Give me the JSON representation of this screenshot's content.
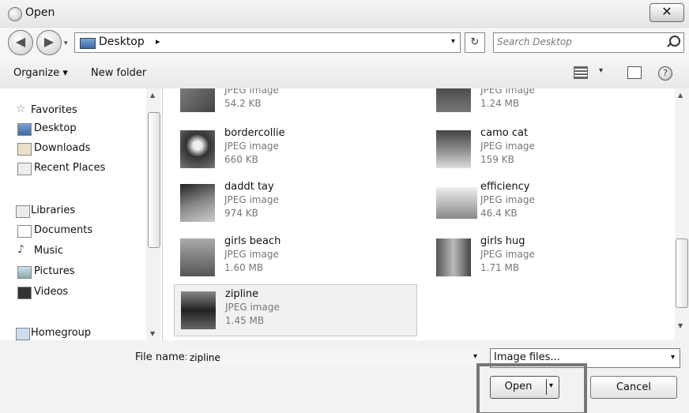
{
  "window": {
    "title": "Open",
    "close_glyph": "✕"
  },
  "nav_buttons": {
    "back_glyph": "◀",
    "forward_glyph": "▶",
    "dropdown_glyph": "▾"
  },
  "address": {
    "path": "Desktop",
    "separator": "▸",
    "dropdown_glyph": "▾",
    "refresh_glyph": "↻"
  },
  "search": {
    "placeholder": "Search Desktop"
  },
  "toolbar": {
    "organize_label": "Organize ▾",
    "new_folder_label": "New folder",
    "view_dropdown_glyph": "▾",
    "help_glyph": "?"
  },
  "nav_pane": {
    "favorites": {
      "label": "Favorites",
      "items": [
        "Desktop",
        "Downloads",
        "Recent Places"
      ]
    },
    "libraries": {
      "label": "Libraries",
      "items": [
        "Documents",
        "Music",
        "Pictures",
        "Videos"
      ]
    },
    "homegroup_label": "Homegroup",
    "scroll_up_glyph": "▲",
    "scroll_down_glyph": "▼"
  },
  "files": [
    {
      "name": "",
      "type": "JPEG image",
      "size": "54.2 KB"
    },
    {
      "name": "",
      "type": "JPEG image",
      "size": "1.24 MB"
    },
    {
      "name": "bordercollie",
      "type": "JPEG image",
      "size": "660 KB"
    },
    {
      "name": "camo cat",
      "type": "JPEG image",
      "size": "159 KB"
    },
    {
      "name": "daddt tay",
      "type": "JPEG image",
      "size": "974 KB"
    },
    {
      "name": "efficiency",
      "type": "JPEG image",
      "size": "46.4 KB"
    },
    {
      "name": "girls beach",
      "type": "JPEG image",
      "size": "1.60 MB"
    },
    {
      "name": "girls hug",
      "type": "JPEG image",
      "size": "1.71 MB"
    },
    {
      "name": "zipline",
      "type": "JPEG image",
      "size": "1.45 MB"
    }
  ],
  "file_scroll": {
    "up_glyph": "▲",
    "down_glyph": "▼"
  },
  "bottom": {
    "file_name_label": "File name:",
    "file_name_value": "zipline",
    "file_name_dropdown_glyph": "▾",
    "file_type": "Image files...",
    "file_type_dropdown_glyph": "▾",
    "open_label": "Open",
    "open_dropdown_glyph": "▾",
    "cancel_label": "Cancel"
  }
}
